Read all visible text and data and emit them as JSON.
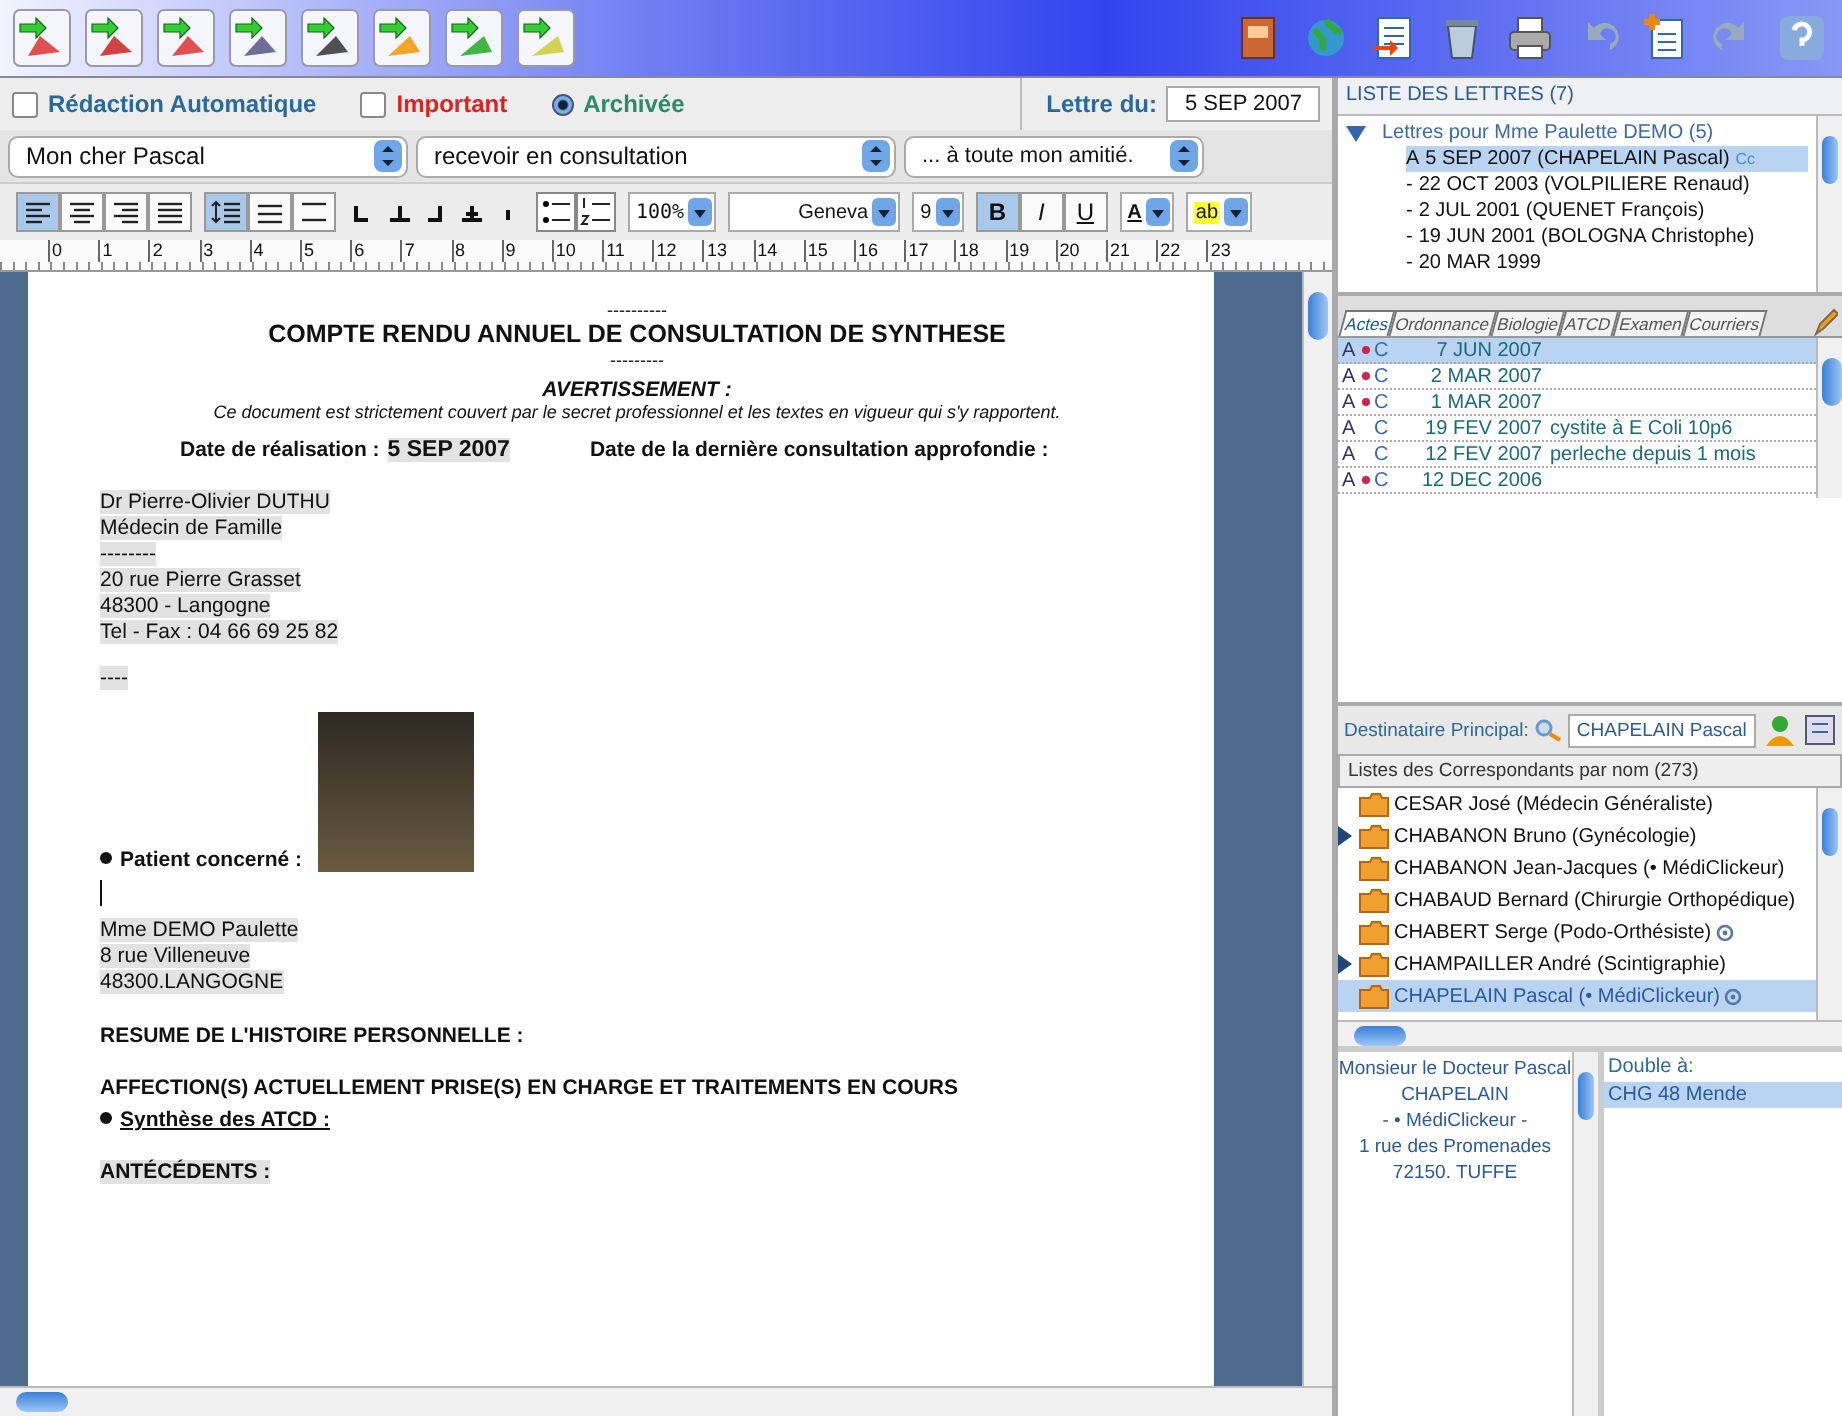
{
  "options": {
    "auto_redaction": {
      "label": "Rédaction Automatique",
      "checked": false
    },
    "important": {
      "label": "Important",
      "checked": false
    },
    "archived": {
      "label": "Archivée",
      "selected": true
    }
  },
  "letter_date": {
    "label": "Lettre du:",
    "value": "5 SEP 2007"
  },
  "phrase_popups": [
    "Mon cher Pascal",
    "recevoir en consultation",
    "... à toute mon amitié."
  ],
  "format_toolbar": {
    "align_buttons": [
      {
        "selected": true
      },
      {
        "selected": false
      },
      {
        "selected": false
      },
      {
        "selected": false
      }
    ],
    "spacing_buttons": [
      {
        "selected": true
      },
      {
        "selected": false
      },
      {
        "selected": false
      }
    ],
    "zoom": "100%",
    "font": "Geneva",
    "size": "9",
    "style_buttons": [
      {
        "label": "B",
        "selected": true
      },
      {
        "label": "I",
        "selected": false
      },
      {
        "label": "U",
        "selected": false
      }
    ],
    "text_color": "A",
    "highlight": "ab"
  },
  "ruler": [
    "0",
    "1",
    "2",
    "3",
    "4",
    "5",
    "6",
    "7",
    "8",
    "9",
    "10",
    "11",
    "12",
    "13",
    "14",
    "15",
    "16",
    "17",
    "18",
    "19",
    "20",
    "21",
    "22",
    "23"
  ],
  "document": [
    {
      "kind": "rule",
      "text": "----------"
    },
    {
      "kind": "title",
      "text": "COMPTE RENDU ANNUEL DE CONSULTATION DE SYNTHESE"
    },
    {
      "kind": "rule",
      "text": "---------"
    },
    {
      "kind": "subtitle",
      "text": "AVERTISSEMENT :"
    },
    {
      "kind": "notice",
      "text": "Ce document est strictement couvert par le secret professionnel et les textes en vigueur qui s'y rapportent."
    },
    {
      "kind": "dates",
      "items": [
        {
          "label": "Date de réalisation :",
          "value": "5 SEP 2007"
        },
        {
          "label": "Date de la dernière consultation approfondie :"
        }
      ]
    },
    {
      "kind": "address",
      "lines": [
        "Dr Pierre-Olivier DUTHU",
        "Médecin de Famille",
        "--------",
        "20 rue Pierre Grasset",
        "48300 - Langogne",
        "Tel - Fax : 04 66 69 25 82"
      ]
    },
    {
      "kind": "address",
      "lines": [
        "----"
      ]
    },
    {
      "kind": "bullet",
      "text": "Patient concerné :",
      "photo": true,
      "underline": false
    },
    {
      "kind": "cursor"
    },
    {
      "kind": "address",
      "lines": [
        "Mme DEMO Paulette",
        "8 rue  Villeneuve",
        "48300.LANGOGNE"
      ]
    },
    {
      "kind": "heading",
      "text": "RESUME DE L'HISTOIRE PERSONNELLE :",
      "field": false
    },
    {
      "kind": "heading",
      "text": "AFFECTION(S) ACTUELLEMENT PRISE(S) EN CHARGE ET TRAITEMENTS EN COURS",
      "field": false
    },
    {
      "kind": "bullet",
      "text": "Synthèse des ATCD :",
      "photo": false,
      "underline": true
    },
    {
      "kind": "heading",
      "text": "ANTÉCÉDENTS :",
      "field": true
    }
  ],
  "letters": {
    "title": "LISTE DES LETTRES (7)",
    "group": {
      "label": "Lettres pour Mme Paulette DEMO (5)",
      "expanded": true,
      "children": [
        {
          "prefix": "A",
          "label": "5 SEP 2007 (CHAPELAIN Pascal)",
          "badge": "Cc",
          "selected": true
        },
        {
          "prefix": "-",
          "label": "22 OCT 2003 (VOLPILIERE Renaud)",
          "selected": false
        },
        {
          "prefix": "-",
          "label": "2 JUL 2001 (QUENET François)",
          "selected": false
        },
        {
          "prefix": "-",
          "label": "19 JUN 2001 (BOLOGNA Christophe)",
          "selected": false
        },
        {
          "prefix": "-",
          "label": "20 MAR 1999",
          "selected": false
        }
      ]
    }
  },
  "tabs": [
    {
      "label": "Actes",
      "selected": true
    },
    {
      "label": "Ordonnance",
      "selected": false
    },
    {
      "label": "Biologie",
      "selected": false
    },
    {
      "label": "ATCD",
      "selected": false
    },
    {
      "label": "Examen",
      "selected": false
    },
    {
      "label": "Courriers",
      "selected": false
    }
  ],
  "acts": [
    {
      "a": "A",
      "c": "C",
      "dot": true,
      "date": "7 JUN 2007",
      "selected": true
    },
    {
      "a": "A",
      "c": "C",
      "dot": true,
      "date": "2 MAR 2007",
      "selected": false
    },
    {
      "a": "A",
      "c": "C",
      "dot": true,
      "date": "1 MAR 2007",
      "selected": false
    },
    {
      "a": "A",
      "c": "C",
      "dot": false,
      "date": "19 FEV 2007",
      "note": "cystite à E Coli 10p6",
      "selected": false
    },
    {
      "a": "A",
      "c": "C",
      "dot": false,
      "date": "12 FEV 2007",
      "note": "perleche depuis 1 mois",
      "selected": false
    },
    {
      "a": "A",
      "c": "C",
      "dot": true,
      "date": "12 DEC 2006",
      "selected": false
    }
  ],
  "recipient": {
    "label": "Destinataire Principal:",
    "value": "CHAPELAIN Pascal"
  },
  "correspondents": {
    "title": "Listes des Correspondants par nom (273)",
    "items": [
      {
        "name": "CESAR José (Médecin Généraliste)",
        "marked": false,
        "email": false,
        "selected": false
      },
      {
        "name": "CHABANON Bruno (Gynécologie)",
        "marked": true,
        "email": false,
        "selected": false
      },
      {
        "name": "CHABANON Jean-Jacques (• MédiClickeur)",
        "marked": false,
        "email": false,
        "selected": false
      },
      {
        "name": "CHABAUD Bernard (Chirurgie Orthopédique)",
        "marked": false,
        "email": false,
        "selected": false
      },
      {
        "name": "CHABERT Serge (Podo-Orthésiste)",
        "marked": false,
        "email": true,
        "selected": false
      },
      {
        "name": "CHAMPAILLER André (Scintigraphie)",
        "marked": true,
        "email": false,
        "selected": false
      },
      {
        "name": "CHAPELAIN Pascal (• MédiClickeur)",
        "marked": false,
        "email": true,
        "selected": true
      }
    ]
  },
  "address": [
    "Monsieur le Docteur Pascal",
    "CHAPELAIN",
    "- • MédiClickeur -",
    "1 rue des Promenades",
    "72150. TUFFE"
  ],
  "copies": {
    "label": "Double à:",
    "items": [
      {
        "label": "CHG 48 Mende",
        "selected": true
      }
    ]
  }
}
